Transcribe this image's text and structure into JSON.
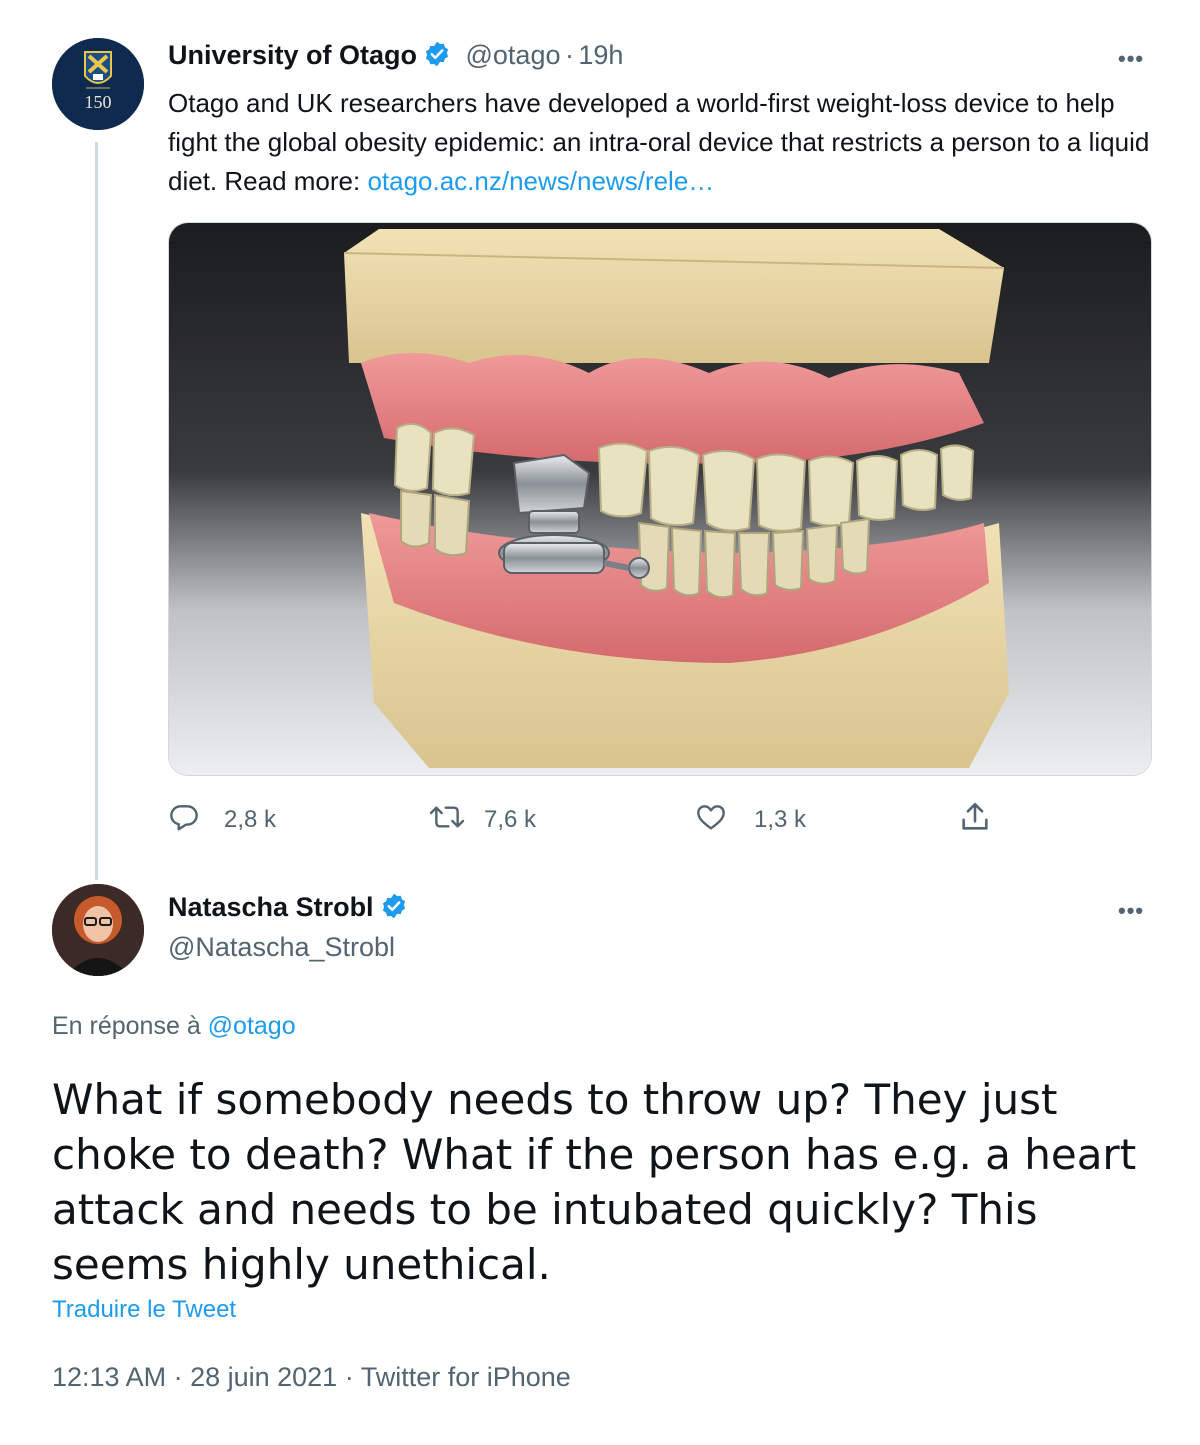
{
  "tweet1": {
    "name": "University of Otago",
    "handle": "@otago",
    "sep": "·",
    "time": "19h",
    "avatar_text": "150",
    "text": "Otago and UK researchers have developed a world-first weight-loss device to help fight the global obesity epidemic: an intra-oral device that restricts a person to a liquid diet. Read more: ",
    "link": "otago.ac.nz/news/news/rele…",
    "more": "•••",
    "actions": {
      "reply_count": "2,8 k",
      "retweet_count": "7,6 k",
      "like_count": "1,3 k"
    }
  },
  "tweet2": {
    "name": "Natascha Strobl",
    "handle": "@Natascha_Strobl",
    "more": "•••",
    "reply_prefix": "En réponse à",
    "reply_to": "@otago",
    "text": "What if somebody needs to throw up? They just choke to death? What if the person has e.g. a heart attack and needs to be intubated quickly? This seems highly unethical.",
    "translate": "Traduire le Tweet",
    "meta": "12:13 AM · 28 juin 2021 · Twitter for iPhone"
  },
  "colors": {
    "accent": "#1d9bf0",
    "secondary_text": "#536471",
    "thread_line": "#cfd9de"
  },
  "icons": [
    "verified-badge-icon",
    "more-icon",
    "reply-icon",
    "retweet-icon",
    "like-icon",
    "share-icon"
  ]
}
